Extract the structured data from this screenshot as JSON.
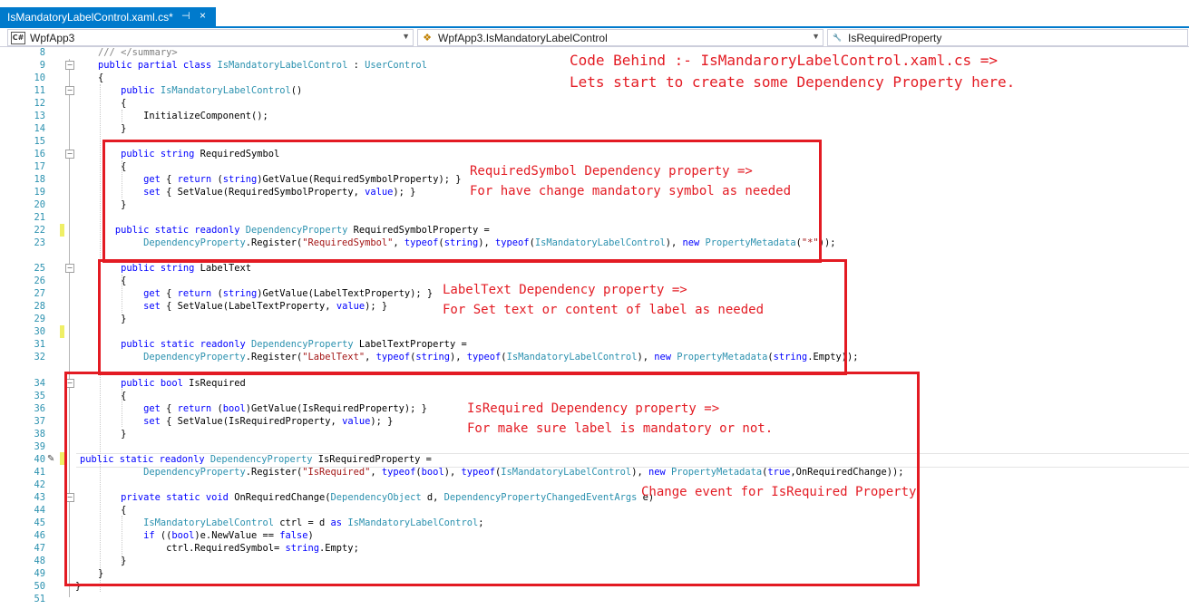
{
  "tab": {
    "title": "IsMandatoryLabelControl.xaml.cs*",
    "pin": "⊣",
    "close": "×"
  },
  "nav": {
    "project": "WpfApp3",
    "type": "WpfApp3.IsMandatoryLabelControl",
    "member": "IsRequiredProperty",
    "icons": [
      "csharp-project-icon",
      "class-icon",
      "property-icon"
    ]
  },
  "code_lines": [
    {
      "n": "8",
      "text": "        /// </summary>"
    },
    {
      "n": "9",
      "text": "        public partial class IsMandatoryLabelControl : UserControl"
    },
    {
      "n": "10",
      "text": "        {"
    },
    {
      "n": "11",
      "text": "            public IsMandatoryLabelControl()"
    },
    {
      "n": "12",
      "text": "            {"
    },
    {
      "n": "13",
      "text": "                InitializeComponent();"
    },
    {
      "n": "14",
      "text": "            }"
    },
    {
      "n": "15",
      "text": ""
    },
    {
      "n": "16",
      "text": "            public string RequiredSymbol"
    },
    {
      "n": "17",
      "text": "            {"
    },
    {
      "n": "18",
      "text": "                get { return (string)GetValue(RequiredSymbolProperty); }"
    },
    {
      "n": "19",
      "text": "                set { SetValue(RequiredSymbolProperty, value); }"
    },
    {
      "n": "20",
      "text": "            }"
    },
    {
      "n": "21",
      "text": ""
    },
    {
      "n": "22",
      "text": "           public static readonly DependencyProperty RequiredSymbolProperty ="
    },
    {
      "n": "23",
      "text": "                DependencyProperty.Register(\"RequiredSymbol\", typeof(string), typeof(IsMandatoryLabelControl), new PropertyMetadata(\"*\"));"
    },
    {
      "n": "25",
      "text": "            public string LabelText"
    },
    {
      "n": "26",
      "text": "            {"
    },
    {
      "n": "27",
      "text": "                get { return (string)GetValue(LabelTextProperty); }"
    },
    {
      "n": "28",
      "text": "                set { SetValue(LabelTextProperty, value); }"
    },
    {
      "n": "29",
      "text": "            }"
    },
    {
      "n": "30",
      "text": ""
    },
    {
      "n": "31",
      "text": "            public static readonly DependencyProperty LabelTextProperty ="
    },
    {
      "n": "32",
      "text": "                DependencyProperty.Register(\"LabelText\", typeof(string), typeof(IsMandatoryLabelControl), new PropertyMetadata(string.Empty));"
    },
    {
      "n": "34",
      "text": "            public bool IsRequired"
    },
    {
      "n": "35",
      "text": "            {"
    },
    {
      "n": "36",
      "text": "                get { return (bool)GetValue(IsRequiredProperty); }"
    },
    {
      "n": "37",
      "text": "                set { SetValue(IsRequiredProperty, value); }"
    },
    {
      "n": "38",
      "text": "            }"
    },
    {
      "n": "39",
      "text": ""
    },
    {
      "n": "40",
      "text": "public static readonly DependencyProperty IsRequiredProperty ="
    },
    {
      "n": "41",
      "text": "                DependencyProperty.Register(\"IsRequired\", typeof(bool), typeof(IsMandatoryLabelControl), new PropertyMetadata(true,OnRequiredChange));"
    },
    {
      "n": "42",
      "text": ""
    },
    {
      "n": "43",
      "text": "            private static void OnRequiredChange(DependencyObject d, DependencyPropertyChangedEventArgs e)"
    },
    {
      "n": "44",
      "text": "            {"
    },
    {
      "n": "45",
      "text": "                IsMandatoryLabelControl ctrl = d as IsMandatoryLabelControl;"
    },
    {
      "n": "46",
      "text": "                if ((bool)e.NewValue == false)"
    },
    {
      "n": "47",
      "text": "                    ctrl.RequiredSymbol= string.Empty;"
    },
    {
      "n": "48",
      "text": "            }"
    },
    {
      "n": "49",
      "text": "        }"
    },
    {
      "n": "50",
      "text": "    }"
    },
    {
      "n": "51",
      "text": ""
    }
  ],
  "annotations": {
    "header_line1": "Code Behind :- IsMandaroryLabelControl.xaml.cs =>",
    "header_line2": "Lets start to create some Dependency Property here.",
    "required_symbol_line1": "RequiredSymbol Dependency property =>",
    "required_symbol_line2": "For have change mandatory symbol as needed",
    "label_text_line1": "LabelText Dependency property =>",
    "label_text_line2": "For Set text or content of label as needed",
    "is_required_line1": "IsRequired Dependency property =>",
    "is_required_line2": "For make sure label is mandatory or not.",
    "change_event": "Change event for IsRequired Property",
    "accent_color": "#e31b23"
  },
  "colors": {
    "tab_active": "#007acc",
    "keyword": "#0000ff",
    "type": "#2b91af",
    "string": "#a31515",
    "line_number": "#2b91af"
  }
}
